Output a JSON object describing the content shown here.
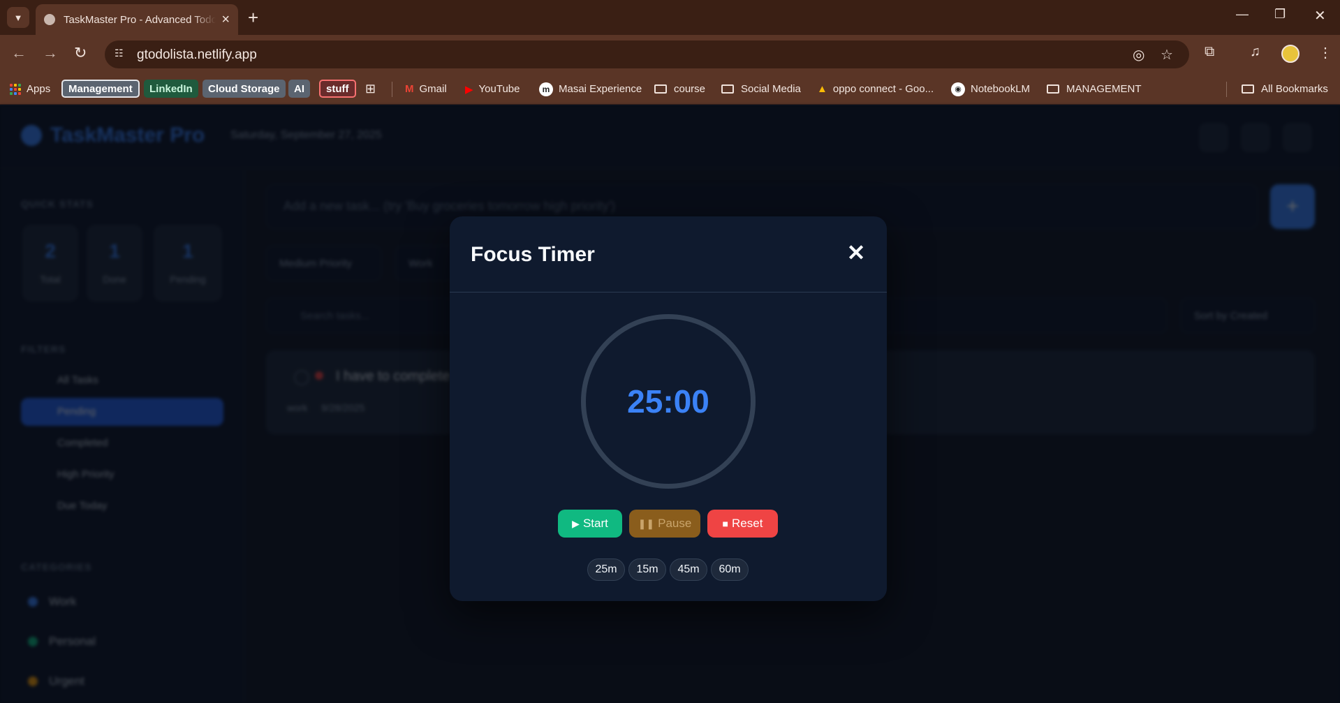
{
  "browser": {
    "tab_title": "TaskMaster Pro - Advanced Todo List",
    "url": "gtodolista.netlify.app",
    "bookmarks": {
      "apps": "Apps",
      "chips": [
        {
          "label": "Management",
          "color": "#5b6470"
        },
        {
          "label": "LinkedIn",
          "color": "#1f5a3d"
        },
        {
          "label": "Cloud Storage",
          "color": "#5b6470"
        },
        {
          "label": "AI",
          "color": "#5b6470"
        },
        {
          "label": "stuff",
          "color": "#6a2b2b"
        }
      ],
      "links": [
        "Gmail",
        "YouTube",
        "Masai Experience",
        "course",
        "Social Media",
        "oppo connect - Goo...",
        "NotebookLM",
        "MANAGEMENT"
      ],
      "all_bookmarks": "All Bookmarks"
    }
  },
  "app": {
    "logo": "TaskMaster Pro",
    "date": "Saturday, September 27, 2025",
    "sidebar": {
      "quick_stats_heading": "QUICK STATS",
      "stats": [
        {
          "value": "2",
          "label": "Total"
        },
        {
          "value": "1",
          "label": "Done"
        },
        {
          "value": "1",
          "label": "Pending"
        }
      ],
      "filters_heading": "FILTERS",
      "filters": [
        "All Tasks",
        "Pending",
        "Completed",
        "High Priority",
        "Due Today"
      ],
      "active_filter": "Pending",
      "categories_heading": "CATEGORIES",
      "categories": [
        {
          "label": "Work",
          "color": "#3b82f6"
        },
        {
          "label": "Personal",
          "color": "#10b981"
        },
        {
          "label": "Urgent",
          "color": "#f59e0b"
        }
      ]
    },
    "main": {
      "task_input_placeholder": "Add a new task... (try 'Buy groceries tomorrow high priority')",
      "add_button": "+",
      "priority_select": "Medium Priority",
      "category_select": "Work",
      "search_placeholder": "Search tasks...",
      "sort_select": "Sort by Created",
      "task": {
        "text": "I have to complete",
        "category": "work",
        "date": "9/28/2025"
      }
    }
  },
  "modal": {
    "title": "Focus Timer",
    "close_icon": "close-icon",
    "time": "25:00",
    "buttons": {
      "start": "Start",
      "pause": "Pause",
      "reset": "Reset"
    },
    "presets": [
      "25m",
      "15m",
      "45m",
      "60m"
    ],
    "colors": {
      "start": "#10b981",
      "pause": "#8a5d1c",
      "reset": "#ef4444",
      "timer": "#3b82f6"
    }
  }
}
